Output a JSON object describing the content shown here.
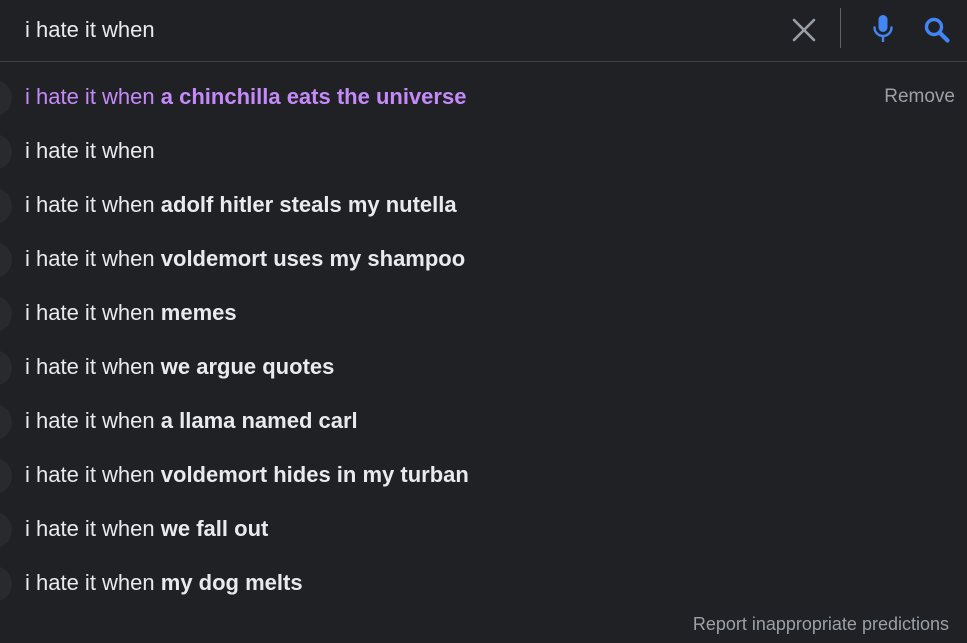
{
  "search": {
    "value": "i hate it when",
    "clear_icon": "close-icon",
    "mic_icon": "mic-icon",
    "search_icon": "search-icon",
    "accent_color": "#4285f4"
  },
  "suggestions": {
    "visited_color": "#c58af9",
    "items": [
      {
        "prefix": "i hate it when",
        "completion": "a chinchilla eats the universe",
        "visited": true,
        "remove_label": "Remove"
      },
      {
        "prefix": "i hate it when",
        "completion": "",
        "visited": false
      },
      {
        "prefix": "i hate it when",
        "completion": "adolf hitler steals my nutella",
        "visited": false
      },
      {
        "prefix": "i hate it when",
        "completion": "voldemort uses my shampoo",
        "visited": false
      },
      {
        "prefix": "i hate it when",
        "completion": "memes",
        "visited": false
      },
      {
        "prefix": "i hate it when",
        "completion": "we argue quotes",
        "visited": false
      },
      {
        "prefix": "i hate it when",
        "completion": "a llama named carl",
        "visited": false
      },
      {
        "prefix": "i hate it when",
        "completion": "voldemort hides in my turban",
        "visited": false
      },
      {
        "prefix": "i hate it when",
        "completion": "we fall out",
        "visited": false
      },
      {
        "prefix": "i hate it when",
        "completion": "my dog melts",
        "visited": false
      }
    ]
  },
  "footer": {
    "report_label": "Report inappropriate predictions"
  }
}
